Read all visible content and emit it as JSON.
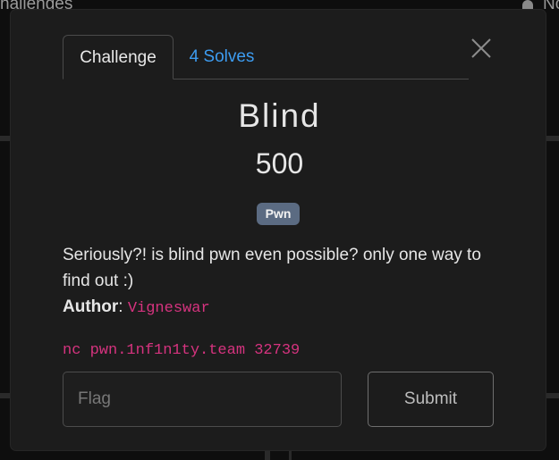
{
  "background": {
    "nav_left_text": "hallenges",
    "nav_right_text": "No"
  },
  "modal": {
    "tabs": [
      {
        "label": "Challenge",
        "active": true
      },
      {
        "label": "4 Solves",
        "active": false
      }
    ],
    "close_icon": "close-icon",
    "challenge": {
      "name": "Blind",
      "value": "500",
      "category": "Pwn",
      "description": "Seriously?! is blind pwn even possible? only one way to find out :)",
      "author_label": "Author",
      "author_sep": ":",
      "author_name": "Vigneswar",
      "connection": "nc pwn.1nf1n1ty.team 32739"
    },
    "form": {
      "flag_placeholder": "Flag",
      "flag_value": "",
      "submit_label": "Submit"
    }
  },
  "colors": {
    "accent_link": "#3d9cf0",
    "code_pink": "#d6337f",
    "badge_bg": "#5b6b82",
    "modal_bg": "#1c1c1c"
  }
}
